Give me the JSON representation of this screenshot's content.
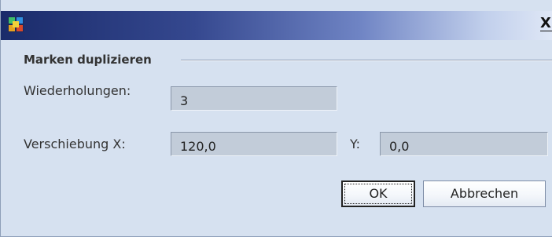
{
  "window": {
    "title": "",
    "close_label": "X"
  },
  "group": {
    "title": "Marken duplizieren"
  },
  "fields": {
    "repetitions_label": "Wiederholungen:",
    "repetitions_value": "3",
    "offset_x_label": "Verschiebung X:",
    "offset_x_value": "120,0",
    "offset_y_label": "Y:",
    "offset_y_value": "0,0"
  },
  "buttons": {
    "ok_label": "OK",
    "cancel_label": "Abbrechen"
  },
  "icons": {
    "app": "app-icon",
    "close": "close-icon"
  },
  "colors": {
    "dialog_background": "#d6e1f0",
    "titlebar_dark": "#1a2b6a",
    "titlebar_light": "#dfe7f6",
    "field_background": "#c2ccd9"
  }
}
